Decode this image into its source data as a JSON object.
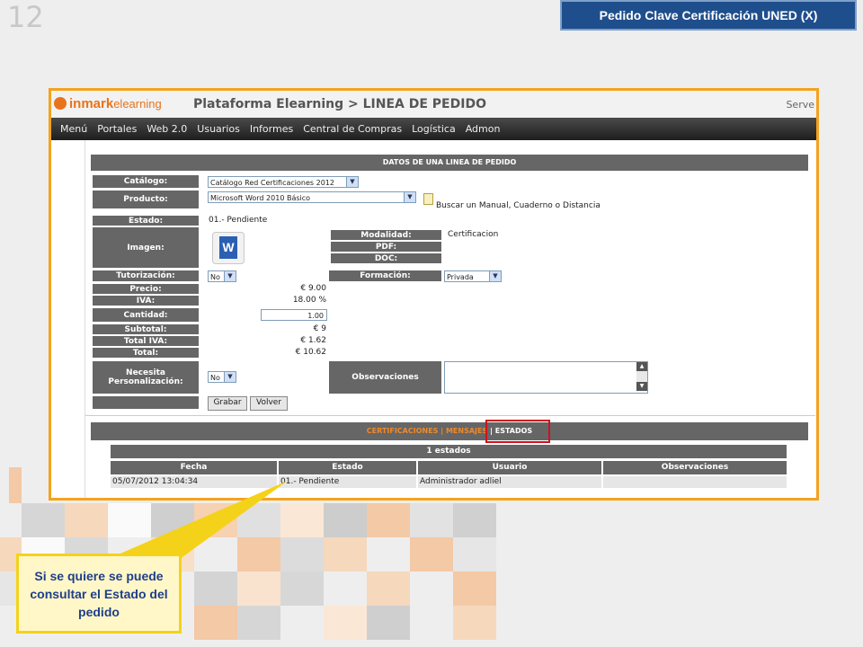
{
  "slide": {
    "number": "12",
    "title": "Pedido Clave Certificación UNED (X)"
  },
  "callout": {
    "text": "Si se quiere se puede consultar el Estado del pedido"
  },
  "app": {
    "logo_brand": "inmark",
    "logo_sub": "elearning",
    "page_title": "Plataforma Elearning > LINEA DE PEDIDO",
    "header_right": "Serve",
    "menu": [
      "Menú",
      "Portales",
      "Web 2.0",
      "Usuarios",
      "Informes",
      "Central de Compras",
      "Logística",
      "Admon"
    ]
  },
  "form": {
    "section_title": "DATOS DE UNA LINEA DE PEDIDO",
    "catalogo_label": "Catálogo:",
    "catalogo_value": "Catálogo Red Certificaciones 2012",
    "producto_label": "Producto:",
    "producto_value": "Microsoft Word 2010 Básico",
    "buscar_text": "Buscar un Manual, Cuaderno o Distancia",
    "estado_label": "Estado:",
    "estado_value": "01.- Pendiente",
    "imagen_label": "Imagen:",
    "modalidad_label": "Modalidad:",
    "modalidad_value": "Certificacion",
    "pdf_label": "PDF:",
    "doc_label": "DOC:",
    "tutorizacion_label": "Tutorización:",
    "tutorizacion_value": "No",
    "formacion_label": "Formación:",
    "formacion_value": "Privada",
    "precio_label": "Precio:",
    "precio_value": "€ 9.00",
    "iva_label": "IVA:",
    "iva_value": "18.00 %",
    "cantidad_label": "Cantidad:",
    "cantidad_value": "1.00",
    "subtotal_label": "Subtotal:",
    "subtotal_value": "€ 9",
    "total_iva_label": "Total IVA:",
    "total_iva_value": "€ 1.62",
    "total_label": "Total:",
    "total_value": "€ 10.62",
    "personalizacion_label": "Necesita Personalización:",
    "personalizacion_value": "No",
    "observaciones_label": "Observaciones",
    "grabar": "Grabar",
    "volver": "Volver"
  },
  "tabs": {
    "certificaciones": "CERTIFICACIONES",
    "mensajes": "| MENSAJES",
    "estados": "| ESTADOS"
  },
  "estados_table": {
    "caption": "1 estados",
    "headers": [
      "Fecha",
      "Estado",
      "Usuario",
      "Observaciones"
    ],
    "rows": [
      [
        "05/07/2012 13:04:34",
        "01.- Pendiente",
        "Administrador adliel",
        ""
      ]
    ]
  },
  "colors": {
    "accent_orange": "#f4a21e",
    "title_blue": "#1f4e8c",
    "highlight_red": "#d0101e"
  }
}
